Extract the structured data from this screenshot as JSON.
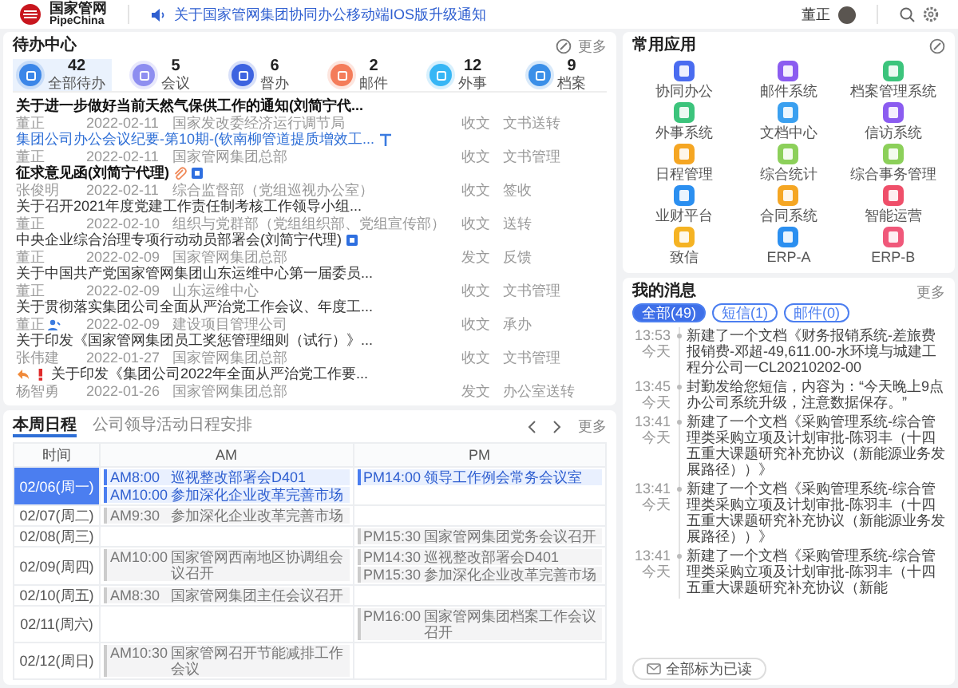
{
  "top_bar": {
    "logo_cn": "国家管网",
    "logo_en": "PipeChina",
    "notice": "关于国家管网集团协同办公移动端IOS版升级通知",
    "user_name": "董正"
  },
  "todo_center": {
    "title": "待办中心",
    "more": "更多",
    "stats": [
      {
        "count": "42",
        "label": "全部待办",
        "selected": true,
        "color": "#3b86e8"
      },
      {
        "count": "5",
        "label": "会议",
        "selected": false,
        "color": "#8e8ef0"
      },
      {
        "count": "6",
        "label": "督办",
        "selected": false,
        "color": "#3d63e0"
      },
      {
        "count": "2",
        "label": "邮件",
        "selected": false,
        "color": "#f47c5a"
      },
      {
        "count": "12",
        "label": "外事",
        "selected": false,
        "color": "#37b6f5"
      },
      {
        "count": "9",
        "label": "档案",
        "selected": false,
        "color": "#3b8fe8"
      }
    ],
    "items": [
      {
        "title": "关于进一步做好当前天然气保供工作的通知(刘简宁代...",
        "unread": true,
        "highlighted": false,
        "person": "董正",
        "date": "2022-02-11",
        "dept": "国家发改委经济运行调节局",
        "type": "收文",
        "action": "文书送转"
      },
      {
        "title": "集团公司办公会议纪要-第10期-(钦南柳管道提质增效工...",
        "unread": false,
        "highlighted": true,
        "person": "董正",
        "date": "2022-02-11",
        "dept": "国家管网集团总部",
        "type": "收文",
        "action": "文书管理",
        "icons": [
          {
            "kind": "pin"
          }
        ]
      },
      {
        "title": "征求意见函(刘简宁代理)",
        "unread": true,
        "highlighted": false,
        "person": "张俊明",
        "date": "2022-02-11",
        "dept": "综合监督部（党组巡视办公室）",
        "type": "收文",
        "action": "签收",
        "icons": [
          {
            "kind": "attachment"
          },
          {
            "kind": "document"
          }
        ]
      },
      {
        "title": "关于召开2021年度党建工作责任制考核工作领导小组...",
        "unread": false,
        "highlighted": false,
        "person": "董正",
        "date": "2022-02-10",
        "dept": "组织与党群部（党组组织部、党组宣传部）",
        "type": "收文",
        "action": "送转"
      },
      {
        "title": "中央企业综合治理专项行动动员部署会(刘简宁代理)",
        "unread": false,
        "highlighted": false,
        "person": "董正",
        "date": "2022-02-09",
        "dept": "国家管网集团总部",
        "type": "发文",
        "action": "反馈",
        "icons": [
          {
            "kind": "document"
          }
        ]
      },
      {
        "title": "关于中国共产党国家管网集团山东运维中心第一届委员...",
        "unread": false,
        "highlighted": false,
        "person": "董正",
        "date": "2022-02-09",
        "dept": "山东运维中心",
        "type": "收文",
        "action": "文书管理"
      },
      {
        "title": "关于贯彻落实集团公司全面从严治党工作会议、年度工...",
        "unread": false,
        "highlighted": false,
        "person": "董正",
        "date": "2022-02-09",
        "dept": "建设项目管理公司",
        "type": "收文",
        "action": "承办",
        "icons": [
          {
            "kind": "person"
          }
        ]
      },
      {
        "title": "关于印发《国家管网集团员工奖惩管理细则（试行）》...",
        "unread": false,
        "highlighted": false,
        "person": "张伟建",
        "date": "2022-01-27",
        "dept": "国家管网集团总部",
        "type": "收文",
        "action": "文书管理"
      },
      {
        "title": "关于印发《集团公司2022年全面从严治党工作要...",
        "unread": false,
        "highlighted": false,
        "person": "杨智勇",
        "date": "2022-01-26",
        "dept": "国家管网集团总部",
        "type": "发文",
        "action": "办公室送转",
        "icons": [
          {
            "kind": "reply"
          },
          {
            "kind": "urgent"
          }
        ]
      }
    ]
  },
  "schedule": {
    "tabs": [
      {
        "label": "本周日程",
        "selected": true
      },
      {
        "label": "公司领导活动日程安排",
        "selected": false
      }
    ],
    "more": "更多",
    "corner": "时间",
    "periods": [
      "AM",
      "PM"
    ],
    "days": [
      {
        "label": "02/06(周一)",
        "selected": true,
        "am": [
          {
            "time": "AM8:00",
            "title": "巡视整改部署会D401"
          },
          {
            "time": "AM10:00",
            "title": "参加深化企业改革完善市场"
          }
        ],
        "pm": [
          {
            "time": "PM14:00",
            "title": "领导工作例会常务会议室"
          }
        ]
      },
      {
        "label": "02/07(周二)",
        "selected": false,
        "am": [
          {
            "time": "AM9:30",
            "title": "参加深化企业改革完善市场"
          }
        ]
      },
      {
        "label": "02/08(周三)",
        "selected": false,
        "pm": [
          {
            "time": "PM15:30",
            "title": "国家管网集团党务会议召开"
          }
        ]
      },
      {
        "label": "02/09(周四)",
        "selected": false,
        "am": [
          {
            "time": "AM10:00",
            "title": "国家管网西南地区协调组会议召开"
          }
        ],
        "pm": [
          {
            "time": "PM14:30",
            "title": "巡视整改部署会D401"
          },
          {
            "time": "PM15:30",
            "title": "参加深化企业改革完善市场"
          }
        ]
      },
      {
        "label": "02/10(周五)",
        "selected": false,
        "am": [
          {
            "time": "AM8:30",
            "title": "国家管网集团主任会议召开"
          }
        ]
      },
      {
        "label": "02/11(周六)",
        "selected": false,
        "pm": [
          {
            "time": "PM16:00",
            "title": "国家管网集团档案工作会议召开"
          }
        ]
      },
      {
        "label": "02/12(周日)",
        "selected": false,
        "am": [
          {
            "time": "AM10:30",
            "title": "国家管网召开节能减排工作会议"
          }
        ]
      }
    ]
  },
  "apps": {
    "title": "常用应用",
    "items": [
      {
        "label": "协同办公",
        "color": "#4a6cf0"
      },
      {
        "label": "邮件系统",
        "color": "#8b5cf0"
      },
      {
        "label": "档案管理系统",
        "color": "#3cc47c"
      },
      {
        "label": "外事系统",
        "color": "#3cc47c"
      },
      {
        "label": "文档中心",
        "color": "#3aa0f0"
      },
      {
        "label": "信访系统",
        "color": "#8b5cf0"
      },
      {
        "label": "日程管理",
        "color": "#f5a623"
      },
      {
        "label": "综合统计",
        "color": "#8cd05a"
      },
      {
        "label": "综合事务管理",
        "color": "#8cd05a"
      },
      {
        "label": "业财平台",
        "color": "#2b8ff0"
      },
      {
        "label": "合同系统",
        "color": "#f5a623"
      },
      {
        "label": "智能运营",
        "color": "#ef4f6a"
      },
      {
        "label": "致信",
        "color": "#f5b323"
      },
      {
        "label": "ERP-A",
        "color": "#2b8ff0"
      },
      {
        "label": "ERP-B",
        "color": "#f0587a"
      }
    ]
  },
  "messages": {
    "title": "我的消息",
    "more": "更多",
    "filters": [
      {
        "label": "全部(49)",
        "selected": true
      },
      {
        "label": "短信(1)",
        "selected": false
      },
      {
        "label": "邮件(0)",
        "selected": false
      }
    ],
    "items": [
      {
        "time": "13:53",
        "day": "今天",
        "text": "新建了一个文档《财务报销系统-差旅费报销费-邓超-49,611.00-水环境与城建工程分公司一CL20210202-00"
      },
      {
        "time": "13:45",
        "day": "今天",
        "text": "封勤发给您短信，内容为：“今天晚上9点办公司系统升级，注意数据保存。”"
      },
      {
        "time": "13:41",
        "day": "今天",
        "text": "新建了一个文档《采购管理系统-综合管理类采购立项及计划审批-陈羽丰（十四五重大课题研究补充协议（新能源业务发展路径））》"
      },
      {
        "time": "13:41",
        "day": "今天",
        "text": "新建了一个文档《采购管理系统-综合管理类采购立项及计划审批-陈羽丰（十四五重大课题研究补充协议（新能源业务发展路径））》"
      },
      {
        "time": "13:41",
        "day": "今天",
        "text": "新建了一个文档《采购管理系统-综合管理类采购立项及计划审批-陈羽丰（十四五重大课题研究补充协议（新能"
      }
    ],
    "mark_all": "全部标为已读"
  }
}
